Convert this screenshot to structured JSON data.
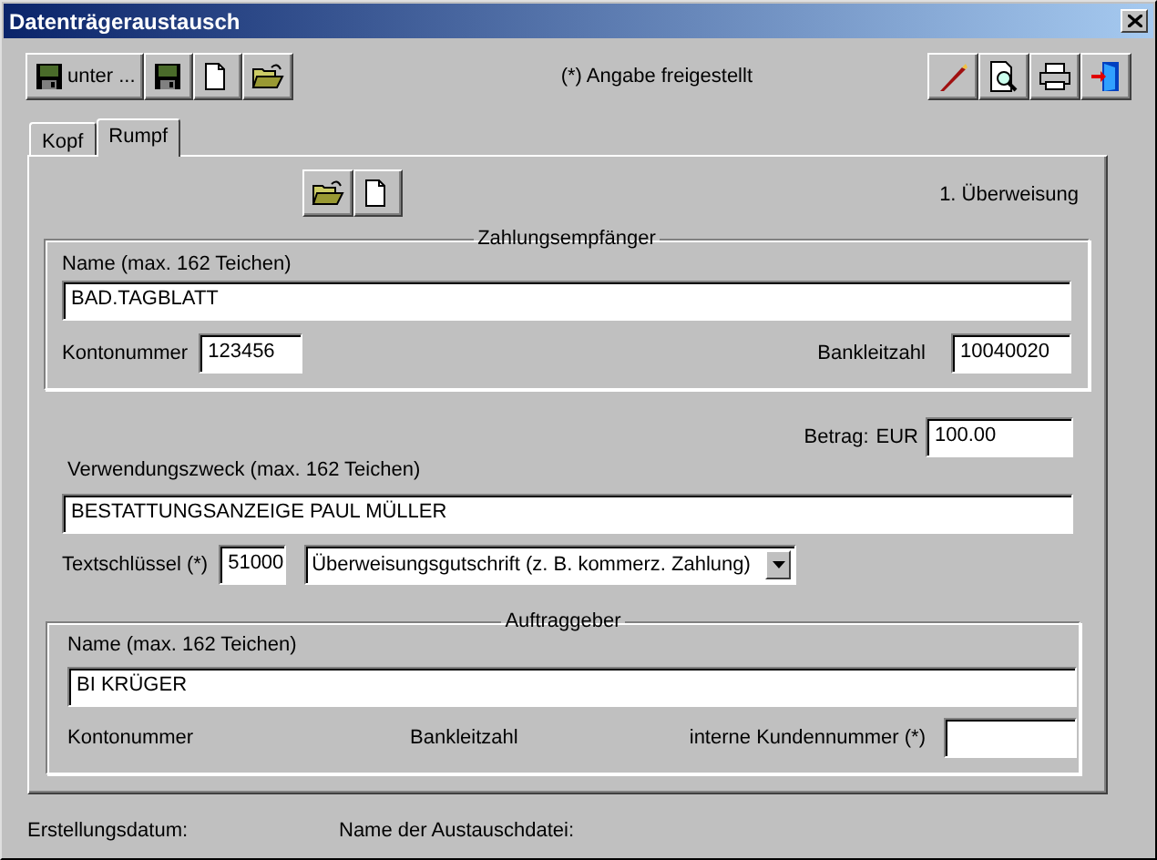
{
  "window": {
    "title": "Datenträgeraustausch"
  },
  "toolbar": {
    "left_buttons": [
      {
        "kind": "save",
        "label": "unter ..."
      },
      {
        "kind": "save"
      },
      {
        "kind": "new"
      },
      {
        "kind": "open"
      }
    ],
    "note": "(*) Angabe freigestellt",
    "right_buttons": [
      {
        "kind": "pencil"
      },
      {
        "kind": "preview"
      },
      {
        "kind": "print"
      },
      {
        "kind": "exit"
      }
    ]
  },
  "tabs": [
    {
      "label": "Kopf",
      "selected": false
    },
    {
      "label": "Rumpf",
      "selected": true
    }
  ],
  "rumpf": {
    "buttons": [
      {
        "kind": "open"
      },
      {
        "kind": "new"
      }
    ],
    "record_label": "1. Überweisung",
    "payee": {
      "title": "Zahlungsempfänger",
      "name_label": "Name (max. 162 Teichen)",
      "name_value": "BAD.TAGBLATT",
      "account_label": "Kontonummer",
      "account_value": "123456",
      "bank_code_label": "Bankleitzahl",
      "bank_code_value": "10040020"
    },
    "amount_label": "Betrag:",
    "currency": "EUR",
    "amount_value": "100.00",
    "purpose_label": "Verwendungszweck (max. 162 Teichen)",
    "purpose_value": "BESTATTUNGSANZEIGE PAUL MÜLLER",
    "text_key_label": "Textschlüssel (*)",
    "text_key_value": "51000",
    "text_key_type": "Überweisungsgutschrift (z. B. kommerz. Zahlung)",
    "payer": {
      "title": "Auftraggeber",
      "name_label": "Name (max. 162 Teichen)",
      "name_value": "BI KRÜGER",
      "account_label": "Kontonummer",
      "bank_code_label": "Bankleitzahl",
      "customer_number_label": "interne Kundennummer (*)"
    }
  },
  "status": {
    "creation_date_label": "Erstellungsdatum:",
    "file_name_label": "Name der Austauschdatei:"
  }
}
